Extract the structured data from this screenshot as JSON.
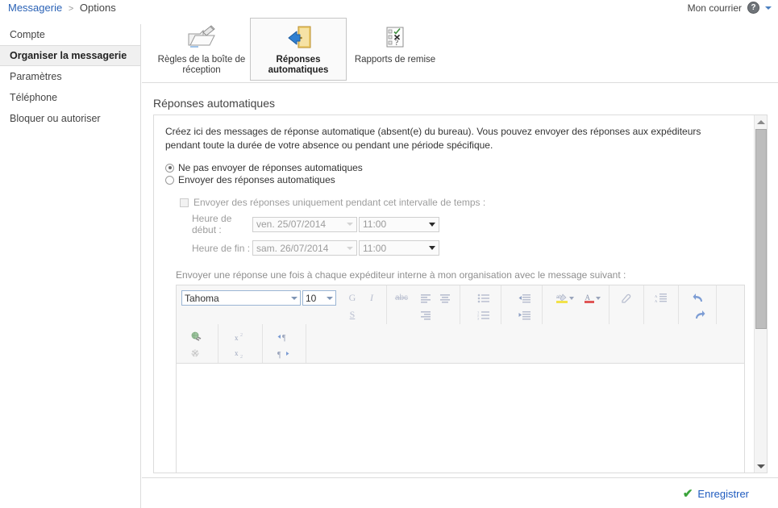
{
  "breadcrumb": {
    "root": "Messagerie",
    "separator": ">",
    "current": "Options"
  },
  "topright": {
    "mailbox_label": "Mon courrier",
    "help_glyph": "?",
    "help_icon": "help-circle-icon",
    "caret_icon": "chevron-down-icon"
  },
  "sidebar": {
    "items": [
      {
        "label": "Compte",
        "selected": false
      },
      {
        "label": "Organiser la messagerie",
        "selected": true
      },
      {
        "label": "Paramètres",
        "selected": false
      },
      {
        "label": "Téléphone",
        "selected": false
      },
      {
        "label": "Bloquer ou autoriser",
        "selected": false
      }
    ]
  },
  "ribbon": {
    "buttons": [
      {
        "label": "Règles de la boîte de réception",
        "icon": "inbox-rules-folder-icon",
        "active": false
      },
      {
        "label": "Réponses automatiques",
        "icon": "automatic-replies-door-icon",
        "active": true
      },
      {
        "label": "Rapports de remise",
        "icon": "delivery-reports-checklist-icon",
        "active": false
      }
    ]
  },
  "content": {
    "section_title": "Réponses automatiques",
    "description": "Créez ici des messages de réponse automatique (absent(e) du bureau). Vous pouvez envoyer des réponses aux expéditeurs pendant toute la durée de votre absence ou pendant une période spécifique.",
    "radios": [
      {
        "label": "Ne pas envoyer de réponses automatiques",
        "checked": true
      },
      {
        "label": "Envoyer des réponses automatiques",
        "checked": false
      }
    ],
    "interval": {
      "checkbox_label": "Envoyer des réponses uniquement pendant cet intervalle de temps :",
      "checkbox_checked": false,
      "start": {
        "label": "Heure de début :",
        "date": "ven. 25/07/2014",
        "time": "11:00"
      },
      "end": {
        "label": "Heure de fin :",
        "date": "sam. 26/07/2014",
        "time": "11:00"
      }
    },
    "message_label": "Envoyer une réponse une fois à chaque expéditeur interne à mon organisation avec le message suivant :",
    "editor": {
      "font_name": "Tahoma",
      "font_size": "10",
      "body_text": "",
      "toolbar": {
        "bold": "G",
        "italic": "I",
        "underline": "S",
        "strikethrough": "abc",
        "align_left": "align-left-icon",
        "align_center": "align-center-icon",
        "align_right": "align-right-icon",
        "bullet_list": "bullet-list-icon",
        "numbered_list": "numbered-list-icon",
        "indent_increase": "indent-increase-icon",
        "indent_decrease": "indent-decrease-icon",
        "highlight": "highlight-color-icon",
        "font_color": "font-color-icon",
        "clear_format": "clear-formatting-icon",
        "line_spacing": "line-spacing-icon",
        "undo": "undo-icon",
        "redo": "redo-icon",
        "insert_link": "insert-hyperlink-icon",
        "remove_link": "remove-hyperlink-icon",
        "superscript": "superscript-icon",
        "subscript": "subscript-icon",
        "ltr": "left-to-right-icon",
        "rtl": "right-to-left-icon"
      }
    }
  },
  "scrollbar": {
    "up_arrow": "scroll-up-arrow",
    "down_arrow": "scroll-down-arrow"
  },
  "footer": {
    "save_label": "Enregistrer",
    "save_icon": "green-check-icon"
  },
  "colors": {
    "link": "#2a62b6",
    "save_link": "#1f5bbf",
    "check_green": "#3aa33a",
    "selected_nav_bg": "#f0f0f0",
    "border": "#dcdcdc",
    "toolbar_bg": "#f7f7f7"
  }
}
